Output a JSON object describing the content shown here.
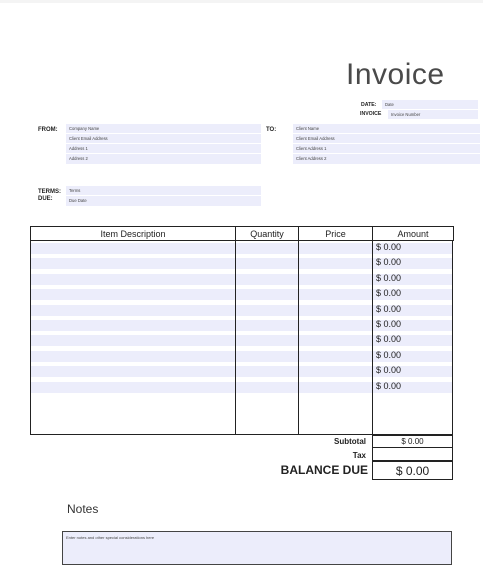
{
  "title": "Invoice",
  "meta": {
    "date_label": "DATE:",
    "date_value": "Date",
    "invoice_label": "INVOICE",
    "invoice_value": "Invoice Number"
  },
  "from": {
    "label": "FROM:",
    "lines": [
      "Company Name",
      "Client Email Address",
      "Address 1",
      "Address 2"
    ]
  },
  "to": {
    "label": "TO:",
    "lines": [
      "Client Name",
      "Client Email Address",
      "Client Address 1",
      "Client Address 2"
    ]
  },
  "terms": {
    "terms_label": "TERMS:",
    "terms_value": "Terms",
    "due_label": "DUE:",
    "due_value": "Due Date"
  },
  "table": {
    "headers": [
      "Item Description",
      "Quantity",
      "Price",
      "Amount"
    ],
    "amounts": [
      "$ 0.00",
      "$ 0.00",
      "$ 0.00",
      "$ 0.00",
      "$ 0.00",
      "$ 0.00",
      "$ 0.00",
      "$ 0.00",
      "$ 0.00",
      "$ 0.00"
    ]
  },
  "totals": {
    "subtotal_label": "Subtotal",
    "subtotal_value": "$ 0.00",
    "tax_label": "Tax",
    "tax_value": "",
    "balance_label": "BALANCE DUE",
    "balance_value": "$ 0.00"
  },
  "notes": {
    "heading": "Notes",
    "placeholder": "Enter notes and other special considerations here"
  },
  "colors": {
    "field_fill": "#ecedfb",
    "border": "#222222"
  }
}
